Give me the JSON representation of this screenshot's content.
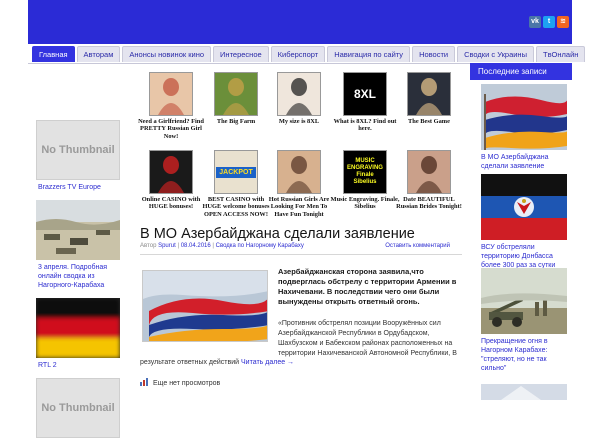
{
  "header": {
    "colors": {
      "brand": "#2b2bd6",
      "nav_active": "#3333e0"
    },
    "social_icons": [
      "vk-icon",
      "twitter-icon",
      "rss-icon"
    ]
  },
  "nav": {
    "tabs": [
      "Главная",
      "Авторам",
      "Анонсы новинок кино",
      "Интересное",
      "Киберспорт",
      "Навигация по сайту",
      "Новости",
      "Сводки с Украины",
      "TвOнлайн"
    ]
  },
  "left": {
    "items": [
      {
        "thumb": "No Thumbnail",
        "caption": "Brazzers TV Europe"
      },
      {
        "thumb": "",
        "caption": "3 апреля. Подробная онлайн сводка из Нагорного-Карабаха"
      },
      {
        "thumb": "",
        "caption": "RTL 2"
      },
      {
        "thumb": "No Thumbnail",
        "caption": ""
      }
    ]
  },
  "ads": [
    {
      "caption": "Need a Girlfriend? Find PRETTY Russian Girl Now!"
    },
    {
      "caption": "The Big Farm"
    },
    {
      "caption": "My size is 8XL"
    },
    {
      "caption": "What is 8XL? Find out here.",
      "img_text": "8XL"
    },
    {
      "caption": "The Best Game"
    },
    {
      "caption": "Online CASINO with HUGE bonuses!"
    },
    {
      "caption": "BEST CASINO with HUGE welcome bonuses OPEN ACCESS NOW!",
      "img_text": "JACKPOT"
    },
    {
      "caption": "Hot Russian Girls Are Looking For Men To Have Fun Tonight"
    },
    {
      "caption": "Music Engraving. Finale, Sibelius",
      "img_text": "MUSIC ENGRAVING Finale Sibelius"
    },
    {
      "caption": "Date BEAUTIFUL Russian Brides Tonight!"
    }
  ],
  "post": {
    "title": "В МО Азербайджана сделали заявление",
    "meta_prefix": "Автор",
    "author": "Spurut",
    "date": "08.04.2016",
    "category": "Сводка по Нагорному Карабаху",
    "comment_link": "Оставить комментарий",
    "lead": "Азербайджанская сторона заявила,что подверглась обстрелу с территории Армении в Нахичевани. В последствии чего они были вынуждены открыть ответный огонь.",
    "quote": "«Противник обстрелял позиции Вооружённых сил Азербайджанской Республики в Ордубадском, Шахбузском и Бабекском районах расположенных на территории Нахичеванской Автономной Республики, В",
    "body_tail": "результате ответных действий",
    "read_more": "Читать далее →",
    "views": "Еще нет просмотров"
  },
  "sidebar": {
    "title": "Последние записи",
    "posts": [
      {
        "caption": "В МО Азербайджана сделали заявление"
      },
      {
        "caption": "ВСУ обстреляли территорию Донбасса более 300 раз за сутки"
      },
      {
        "caption": "Прекращение огня в Нагорном Карабахе: \"стреляют, но не так сильно\""
      }
    ]
  }
}
